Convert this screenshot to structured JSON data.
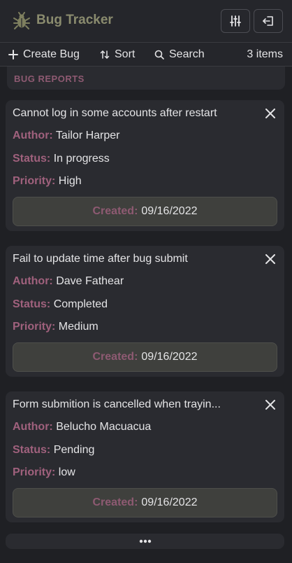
{
  "app": {
    "title": "Bug Tracker",
    "logo_icon": "bug-icon"
  },
  "header_buttons": {
    "filter_icon": "sliders-icon",
    "logout_icon": "logout-icon"
  },
  "toolbar": {
    "create_label": "Create Bug",
    "sort_label": "Sort",
    "search_label": "Search",
    "count_label": "3 items"
  },
  "section": {
    "label": "BUG REPORTS"
  },
  "field_labels": {
    "author": "Author:",
    "status": "Status:",
    "priority": "Priority:",
    "created": "Created:"
  },
  "bugs": [
    {
      "title": "Cannot log in some accounts after restart",
      "author": "Tailor Harper",
      "status": "In progress",
      "priority": "High",
      "created": "09/16/2022"
    },
    {
      "title": "Fail to update time after bug submit",
      "author": "Dave Fathear",
      "status": "Completed",
      "priority": "Medium",
      "created": "09/16/2022"
    },
    {
      "title": "Form submition is cancelled when trayin...",
      "author": "Belucho Macuacua",
      "status": "Pending",
      "priority": "low",
      "created": "09/16/2022"
    }
  ],
  "colors": {
    "background": "#1f2024",
    "card": "#2a2b30",
    "accent_label": "#a0617d",
    "title_olive": "#8a8b6e"
  }
}
